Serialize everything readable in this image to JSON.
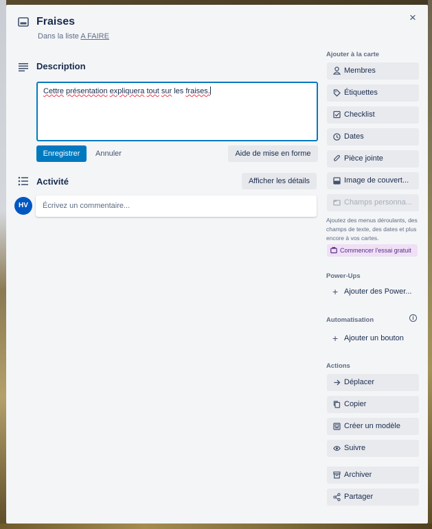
{
  "card": {
    "title": "Fraises",
    "list_prefix": "Dans la liste",
    "list_name": "A FAIRE",
    "close_icon": "×"
  },
  "description": {
    "heading": "Description",
    "words": [
      "Cettre",
      "présentation",
      "expliquera",
      "tout",
      "sur",
      "les",
      "fraises."
    ],
    "save_label": "Enregistrer",
    "cancel_label": "Annuler",
    "format_help_label": "Aide de mise en forme"
  },
  "activity": {
    "heading": "Activité",
    "show_details_label": "Afficher les détails",
    "avatar_initials": "HV",
    "comment_placeholder": "Écrivez un commentaire..."
  },
  "sidebar": {
    "add_to_card_label": "Ajouter à la carte",
    "add_items": [
      {
        "label": "Membres",
        "icon": "person-icon"
      },
      {
        "label": "Étiquettes",
        "icon": "tag-icon"
      },
      {
        "label": "Checklist",
        "icon": "checkbox-icon"
      },
      {
        "label": "Dates",
        "icon": "clock-icon"
      },
      {
        "label": "Pièce jointe",
        "icon": "paperclip-icon"
      },
      {
        "label": "Image de couvert...",
        "icon": "cover-icon"
      },
      {
        "label": "Champs personna...",
        "icon": "custom-field-icon"
      }
    ],
    "promo_text": "Ajoutez des menus déroulants, des champs de texte, des dates et plus encore à vos cartes.",
    "trial_label": "Commencer l'essai gratuit",
    "powerups_label": "Power-Ups",
    "add_powerups_label": "Ajouter des Power...",
    "automation_label": "Automatisation",
    "add_button_label": "Ajouter un bouton",
    "actions_label": "Actions",
    "action_items": [
      {
        "label": "Déplacer",
        "icon": "arrow-right-icon"
      },
      {
        "label": "Copier",
        "icon": "copy-icon"
      },
      {
        "label": "Créer un modèle",
        "icon": "template-icon"
      },
      {
        "label": "Suivre",
        "icon": "eye-icon"
      },
      {
        "label": "Archiver",
        "icon": "archive-icon"
      },
      {
        "label": "Partager",
        "icon": "share-icon"
      }
    ]
  },
  "colors": {
    "primary": "#0079bf",
    "modal_bg": "#f4f5f7",
    "button_bg": "#e9eaee",
    "avatar": "#0057c2",
    "trial_bg": "#efe0f6"
  }
}
